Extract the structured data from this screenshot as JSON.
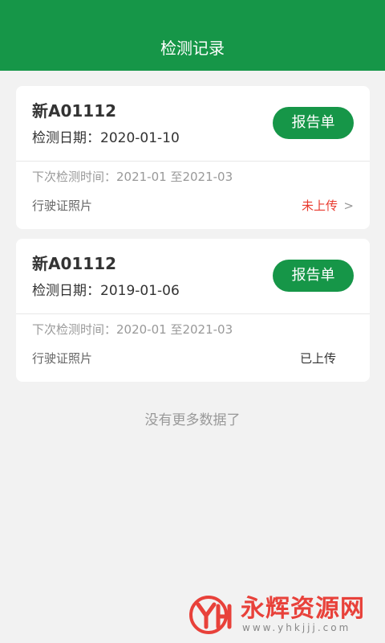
{
  "header": {
    "title": "检测记录"
  },
  "records": [
    {
      "plate": "新A01112",
      "date": "检测日期：2020-01-10",
      "report_label": "报告单",
      "next_time": "下次检测时间：2021-01 至2021-03",
      "photo_label": "行驶证照片",
      "status": "未上传",
      "chevron": ">"
    },
    {
      "plate": "新A01112",
      "date": "检测日期：2019-01-06",
      "report_label": "报告单",
      "next_time": "下次检测时间：2020-01 至2021-03",
      "photo_label": "行驶证照片",
      "status": "已上传"
    }
  ],
  "footer": {
    "no_more": "没有更多数据了"
  },
  "watermark": {
    "name": "永辉资源网",
    "url": "www.yhkjjj.com"
  },
  "colors": {
    "brand": "#169648",
    "status_missing": "#e83a2e"
  }
}
